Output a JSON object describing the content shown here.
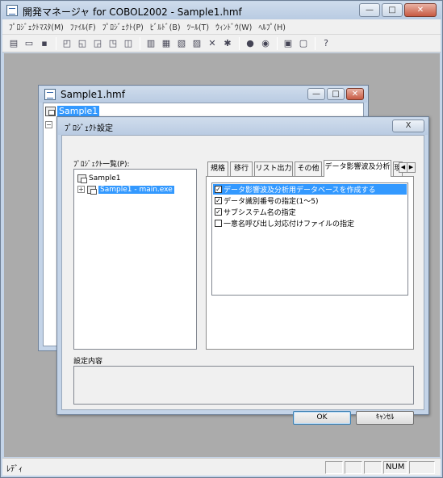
{
  "window": {
    "title": "開発マネージャ for COBOL2002 - Sample1.hmf"
  },
  "menu": [
    {
      "label": "ﾌﾟﾛｼﾞｪｸﾄﾏｽﾀ(M)"
    },
    {
      "label": "ﾌｧｲﾙ(F)"
    },
    {
      "label": "ﾌﾟﾛｼﾞｪｸﾄ(P)"
    },
    {
      "label": "ﾋﾞﾙﾄﾞ(B)"
    },
    {
      "label": "ﾂｰﾙ(T)"
    },
    {
      "label": "ｳｨﾝﾄﾞｳ(W)"
    },
    {
      "label": "ﾍﾙﾌﾟ(H)"
    }
  ],
  "toolbar_icons": [
    "new-project-icon",
    "open-icon",
    "save-icon",
    "copy-icon",
    "cut-icon",
    "paste-icon",
    "delete-icon",
    "print-icon",
    "build-icon",
    "rebuild-icon",
    "compile-icon",
    "link-icon",
    "clean-icon",
    "tool-icon",
    "debug-icon",
    "run-icon",
    "window-icon",
    "window2-icon",
    "help-icon"
  ],
  "doc": {
    "title": "Sample1.hmf",
    "tree_root": "Sample1"
  },
  "dialog": {
    "title": "ﾌﾟﾛｼﾞｪｸﾄ設定",
    "close_label": "X",
    "project_list_label": "ﾌﾟﾛｼﾞｪｸﾄ一覧(P):",
    "tree": {
      "root": "Sample1",
      "child": "Sample1 - main.exe"
    },
    "tabs": [
      {
        "label": "規格"
      },
      {
        "label": "移行"
      },
      {
        "label": "リスト出力"
      },
      {
        "label": "その他"
      },
      {
        "label": "データ影響波及分析"
      },
      {
        "label": "現"
      }
    ],
    "active_tab": 4,
    "options": [
      {
        "label": "データ影響波及分析用データベースを作成する",
        "checked": true,
        "selected": true
      },
      {
        "label": "データ識別番号の指定(1〜5)",
        "checked": true,
        "selected": false
      },
      {
        "label": "サブシステム名の指定",
        "checked": true,
        "selected": false
      },
      {
        "label": "一意名呼び出し対応付けファイルの指定",
        "checked": false,
        "selected": false
      }
    ],
    "description_label": "設定内容",
    "description_text": "",
    "ok_label": "OK",
    "cancel_label": "ｷｬﾝｾﾙ"
  },
  "status": {
    "text": "ﾚﾃﾞｨ",
    "num": "NUM"
  }
}
